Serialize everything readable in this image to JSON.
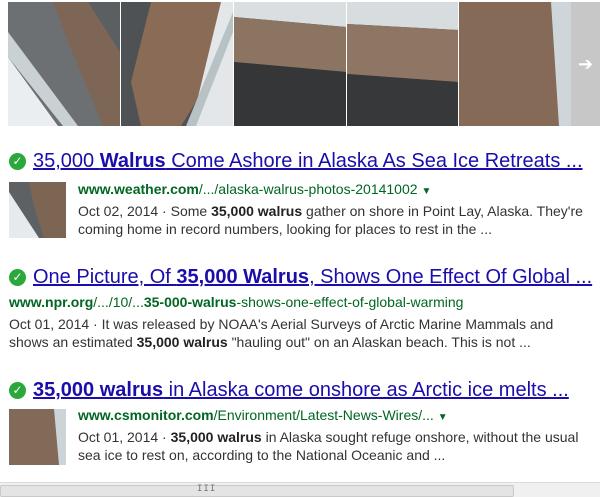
{
  "results": [
    {
      "title_pre": "35,000 ",
      "title_bold": "Walrus",
      "title_post": " Come Ashore in Alaska As Sea Ice Retreats ...",
      "url_domain": "www.weather.com",
      "url_path": "/.../alaska-walrus-photos-20141002",
      "date": "Oct 02, 2014",
      "snippet_a": " · Some ",
      "snippet_b": "35,000 walrus",
      "snippet_c": " gather on shore in Point Lay, Alaska. They're",
      "snippet_line2": "coming home in record numbers, looking for places to rest in the ..."
    },
    {
      "title_pre": "One Picture, Of ",
      "title_bold": "35,000 Walrus",
      "title_post": ", Shows One Effect Of Global ...",
      "url_domain": "www.npr.org",
      "url_path_a": "/.../10/...",
      "url_bold": "35-000-walrus",
      "url_path_b": "-shows-one-effect-of-global-warming",
      "date": "Oct 01, 2014",
      "snippet_line1": " · It was released by NOAA's Aerial Surveys of Arctic Marine Mammals and",
      "snippet_l2a": "shows an estimated ",
      "snippet_l2b": "35,000 walrus",
      "snippet_l2c": " \"hauling out\" on an Alaskan beach. This is not ..."
    },
    {
      "title_bold": "35,000 walrus",
      "title_post": " in Alaska come onshore as Arctic ice melts ...",
      "url_domain": "www.csmonitor.com",
      "url_path": "/Environment/Latest-News-Wires/...",
      "date": "Oct 01, 2014",
      "snippet_a": " · ",
      "snippet_b": "35,000 walrus",
      "snippet_c": " in Alaska sought refuge onshore, without the usual",
      "snippet_line2": "sea ice to rest on, according to the National Oceanic and ..."
    }
  ],
  "icons": {
    "verified": "check-circle-icon",
    "dropdown": "caret-down-icon",
    "next": "arrow-right-icon",
    "grip": "scroll-grip-icon"
  },
  "glyphs": {
    "check": "✓",
    "caret": "▼",
    "arrow": "➔",
    "grip": "III"
  },
  "colors": {
    "link": "#1a0dab",
    "url": "#006621",
    "check": "#2aa83b",
    "snippet": "#333333"
  }
}
